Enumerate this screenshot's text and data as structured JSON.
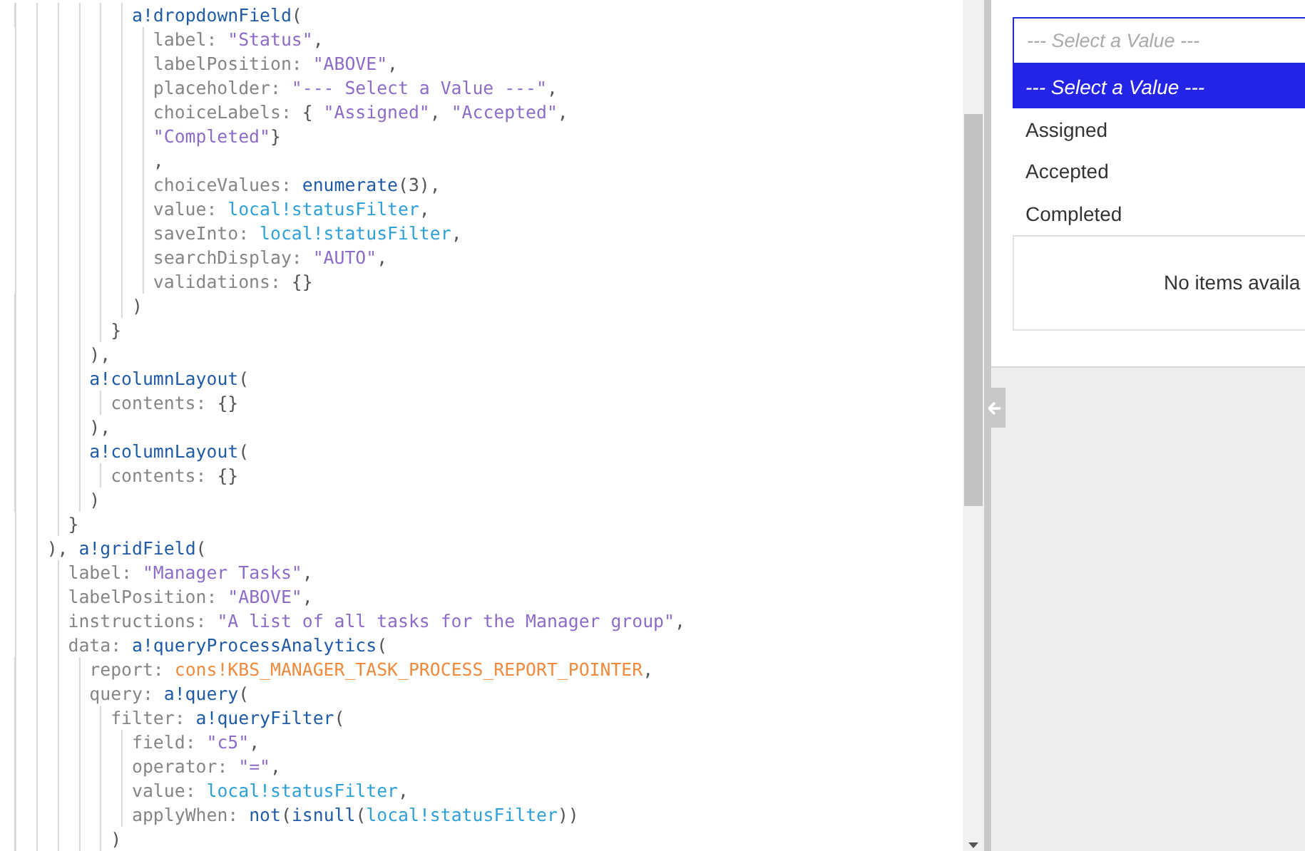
{
  "code_editor": {
    "lines": [
      {
        "children": [
          {
            "children": [
              {
                "children": [
                  {
                    "children": [
                      {
                        "tokens": [
                          {
                            "kind": "fn",
                            "text": "a!dropdownField"
                          },
                          {
                            "kind": "punct",
                            "text": "("
                          }
                        ],
                        "children": [
                          {
                            "tokens": [
                              {
                                "kind": "key",
                                "text": "label: "
                              },
                              {
                                "kind": "str",
                                "text": "\"Status\""
                              },
                              {
                                "kind": "punct",
                                "text": ","
                              }
                            ]
                          },
                          {
                            "tokens": [
                              {
                                "kind": "key",
                                "text": "labelPosition: "
                              },
                              {
                                "kind": "str",
                                "text": "\"ABOVE\""
                              },
                              {
                                "kind": "punct",
                                "text": ","
                              }
                            ]
                          },
                          {
                            "tokens": [
                              {
                                "kind": "key",
                                "text": "placeholder: "
                              },
                              {
                                "kind": "str",
                                "text": "\"--- Select a Value ---\""
                              },
                              {
                                "kind": "punct",
                                "text": ","
                              }
                            ]
                          },
                          {
                            "tokens": [
                              {
                                "kind": "key",
                                "text": "choiceLabels: "
                              },
                              {
                                "kind": "punct",
                                "text": "{ "
                              },
                              {
                                "kind": "str",
                                "text": "\"Assigned\""
                              },
                              {
                                "kind": "punct",
                                "text": ", "
                              },
                              {
                                "kind": "str",
                                "text": "\"Accepted\""
                              },
                              {
                                "kind": "punct",
                                "text": ","
                              }
                            ]
                          },
                          {
                            "tokens": [
                              {
                                "kind": "str",
                                "text": "\"Completed\""
                              },
                              {
                                "kind": "punct",
                                "text": "}"
                              }
                            ]
                          },
                          {
                            "tokens": [
                              {
                                "kind": "punct",
                                "text": ","
                              }
                            ]
                          },
                          {
                            "tokens": [
                              {
                                "kind": "key",
                                "text": "choiceValues: "
                              },
                              {
                                "kind": "fn",
                                "text": "enumerate"
                              },
                              {
                                "kind": "punct",
                                "text": "(3),"
                              }
                            ]
                          },
                          {
                            "tokens": [
                              {
                                "kind": "key",
                                "text": "value: "
                              },
                              {
                                "kind": "var",
                                "text": "local!statusFilter"
                              },
                              {
                                "kind": "punct",
                                "text": ","
                              }
                            ]
                          },
                          {
                            "tokens": [
                              {
                                "kind": "key",
                                "text": "saveInto: "
                              },
                              {
                                "kind": "var",
                                "text": "local!statusFilter"
                              },
                              {
                                "kind": "punct",
                                "text": ","
                              }
                            ]
                          },
                          {
                            "tokens": [
                              {
                                "kind": "key",
                                "text": "searchDisplay: "
                              },
                              {
                                "kind": "str",
                                "text": "\"AUTO\""
                              },
                              {
                                "kind": "punct",
                                "text": ","
                              }
                            ]
                          },
                          {
                            "tokens": [
                              {
                                "kind": "key",
                                "text": "validations: "
                              },
                              {
                                "kind": "punct",
                                "text": "{}"
                              }
                            ]
                          }
                        ]
                      },
                      {
                        "tokens": [
                          {
                            "kind": "punct",
                            "text": ")"
                          }
                        ]
                      }
                    ]
                  },
                  {
                    "tokens": [
                      {
                        "kind": "punct",
                        "text": "}"
                      }
                    ]
                  }
                ]
              },
              {
                "tokens": [
                  {
                    "kind": "punct",
                    "text": "),"
                  }
                ]
              },
              {
                "tokens": [
                  {
                    "kind": "fn",
                    "text": "a!columnLayout"
                  },
                  {
                    "kind": "punct",
                    "text": "("
                  }
                ],
                "children": [
                  {
                    "tokens": [
                      {
                        "kind": "key",
                        "text": "contents: "
                      },
                      {
                        "kind": "punct",
                        "text": "{}"
                      }
                    ]
                  }
                ]
              },
              {
                "tokens": [
                  {
                    "kind": "punct",
                    "text": "),"
                  }
                ]
              },
              {
                "tokens": [
                  {
                    "kind": "fn",
                    "text": "a!columnLayout"
                  },
                  {
                    "kind": "punct",
                    "text": "("
                  }
                ],
                "children": [
                  {
                    "tokens": [
                      {
                        "kind": "key",
                        "text": "contents: "
                      },
                      {
                        "kind": "punct",
                        "text": "{}"
                      }
                    ]
                  }
                ]
              },
              {
                "tokens": [
                  {
                    "kind": "punct",
                    "text": ")"
                  }
                ]
              }
            ]
          },
          {
            "tokens": [
              {
                "kind": "punct",
                "text": "}"
              }
            ]
          }
        ]
      },
      {
        "tokens": [
          {
            "kind": "punct",
            "text": "), "
          },
          {
            "kind": "fn",
            "text": "a!gridField"
          },
          {
            "kind": "punct",
            "text": "("
          }
        ],
        "children": [
          {
            "tokens": [
              {
                "kind": "key",
                "text": "label: "
              },
              {
                "kind": "str",
                "text": "\"Manager Tasks\""
              },
              {
                "kind": "punct",
                "text": ","
              }
            ]
          },
          {
            "tokens": [
              {
                "kind": "key",
                "text": "labelPosition: "
              },
              {
                "kind": "str",
                "text": "\"ABOVE\""
              },
              {
                "kind": "punct",
                "text": ","
              }
            ]
          },
          {
            "tokens": [
              {
                "kind": "key",
                "text": "instructions: "
              },
              {
                "kind": "str",
                "text": "\"A list of all tasks for the Manager group\""
              },
              {
                "kind": "punct",
                "text": ","
              }
            ]
          },
          {
            "tokens": [
              {
                "kind": "key",
                "text": "data: "
              },
              {
                "kind": "fn",
                "text": "a!queryProcessAnalytics"
              },
              {
                "kind": "punct",
                "text": "("
              }
            ],
            "children": [
              {
                "tokens": [
                  {
                    "kind": "key",
                    "text": "report: "
                  },
                  {
                    "kind": "cons",
                    "text": "cons!KBS_MANAGER_TASK_PROCESS_REPORT_POINTER"
                  },
                  {
                    "kind": "punct",
                    "text": ","
                  }
                ]
              },
              {
                "tokens": [
                  {
                    "kind": "key",
                    "text": "query: "
                  },
                  {
                    "kind": "fn",
                    "text": "a!query"
                  },
                  {
                    "kind": "punct",
                    "text": "("
                  }
                ],
                "children": [
                  {
                    "tokens": [
                      {
                        "kind": "key",
                        "text": "filter: "
                      },
                      {
                        "kind": "fn",
                        "text": "a!queryFilter"
                      },
                      {
                        "kind": "punct",
                        "text": "("
                      }
                    ],
                    "children": [
                      {
                        "tokens": [
                          {
                            "kind": "key",
                            "text": "field: "
                          },
                          {
                            "kind": "str",
                            "text": "\"c5\""
                          },
                          {
                            "kind": "punct",
                            "text": ","
                          }
                        ]
                      },
                      {
                        "tokens": [
                          {
                            "kind": "key",
                            "text": "operator: "
                          },
                          {
                            "kind": "str",
                            "text": "\"=\""
                          },
                          {
                            "kind": "punct",
                            "text": ","
                          }
                        ]
                      },
                      {
                        "tokens": [
                          {
                            "kind": "key",
                            "text": "value: "
                          },
                          {
                            "kind": "var",
                            "text": "local!statusFilter"
                          },
                          {
                            "kind": "punct",
                            "text": ","
                          }
                        ]
                      },
                      {
                        "tokens": [
                          {
                            "kind": "key",
                            "text": "applyWhen: "
                          },
                          {
                            "kind": "fn",
                            "text": "not"
                          },
                          {
                            "kind": "punct",
                            "text": "("
                          },
                          {
                            "kind": "fn",
                            "text": "isnull"
                          },
                          {
                            "kind": "punct",
                            "text": "("
                          },
                          {
                            "kind": "var",
                            "text": "local!statusFilter"
                          },
                          {
                            "kind": "punct",
                            "text": "))"
                          }
                        ]
                      }
                    ]
                  },
                  {
                    "tokens": [
                      {
                        "kind": "punct",
                        "text": ")"
                      }
                    ]
                  }
                ]
              }
            ]
          }
        ]
      }
    ]
  },
  "preview": {
    "status_dropdown": {
      "placeholder": "--- Select a Value ---",
      "expanded": true,
      "options": [
        {
          "label": "--- Select a Value ---",
          "selected": true
        },
        {
          "label": "Assigned",
          "selected": false
        },
        {
          "label": "Accepted",
          "selected": false
        },
        {
          "label": "Completed",
          "selected": false
        }
      ]
    },
    "grid": {
      "empty_message": "No items availa"
    }
  }
}
